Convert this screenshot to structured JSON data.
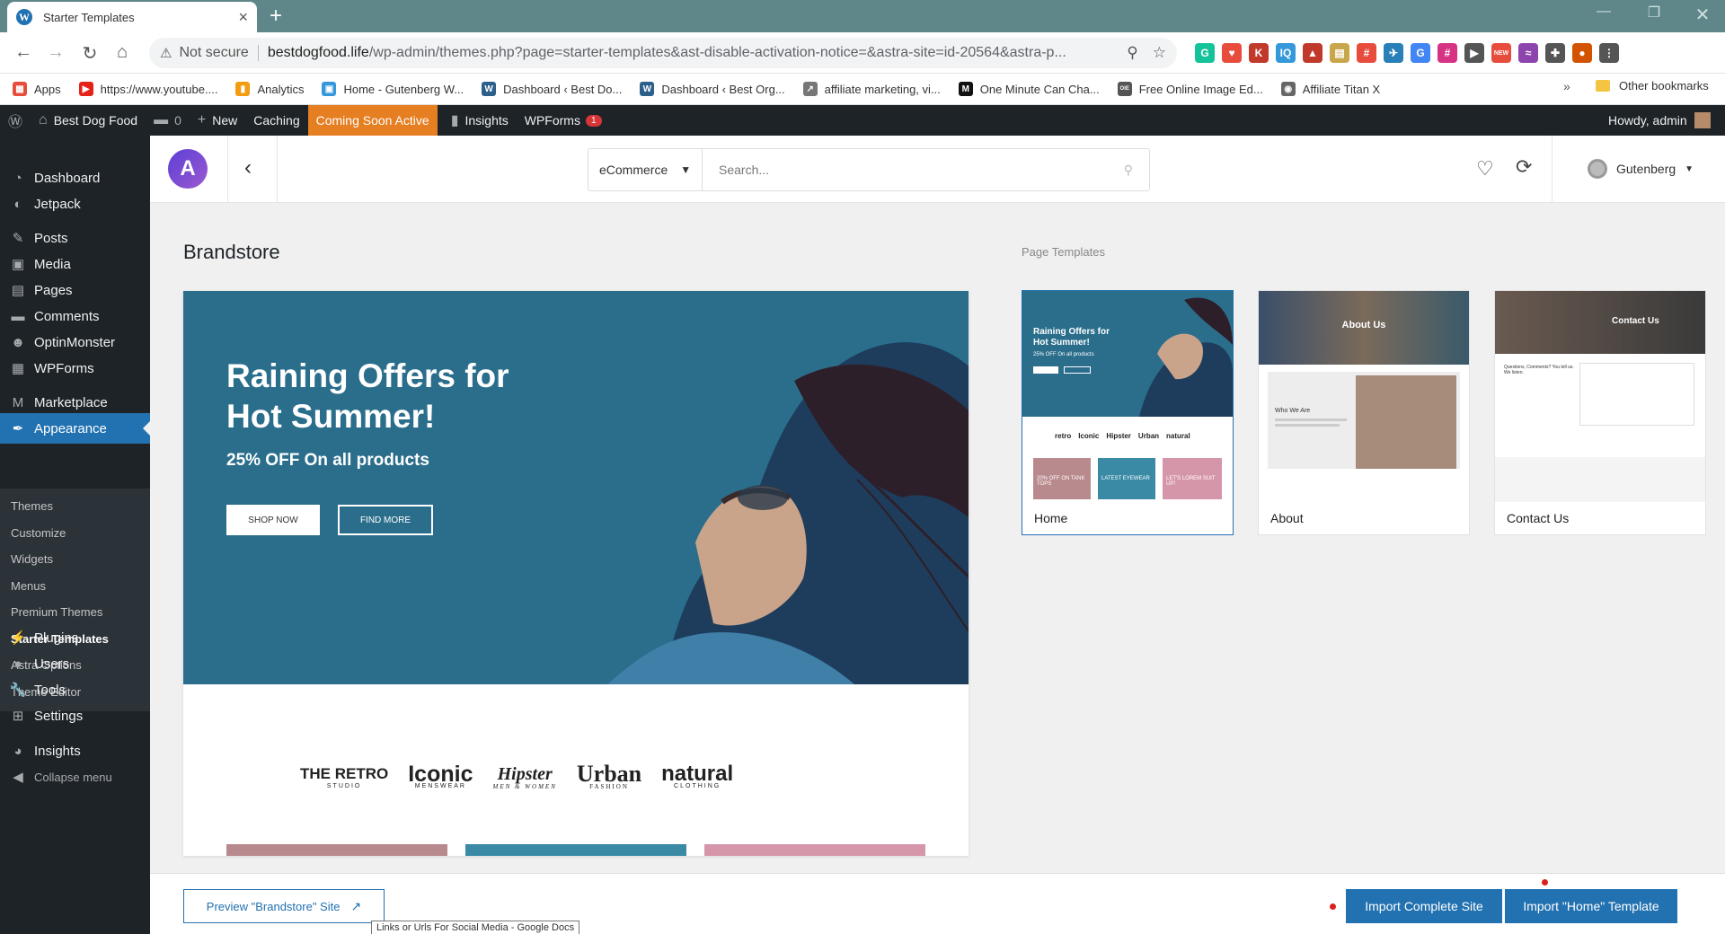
{
  "browser": {
    "tab_title": "Starter Templates",
    "new_tab": "+",
    "url_warning": "Not secure",
    "url_domain": "bestdogfood.life",
    "url_path": "/wp-admin/themes.php?page=starter-templates&ast-disable-activation-notice=&astra-site=id-20564&astra-p...",
    "extensions": [
      {
        "name": "grammarly-icon",
        "color": "#15c39a",
        "glyph": "G"
      },
      {
        "name": "heart-ext-icon",
        "color": "#e74c3c",
        "glyph": "♥"
      },
      {
        "name": "k-ext-icon",
        "color": "#c0392b",
        "glyph": "K"
      },
      {
        "name": "iq-ext-icon",
        "color": "#3498db",
        "glyph": "IQ"
      },
      {
        "name": "red-chart-ext-icon",
        "color": "#c0392b",
        "glyph": "▲"
      },
      {
        "name": "notes-ext-icon",
        "color": "#c8a64a",
        "glyph": "▤"
      },
      {
        "name": "hash-ext-icon",
        "color": "#e74c3c",
        "glyph": "#"
      },
      {
        "name": "wing-ext-icon",
        "color": "#2980b9",
        "glyph": "✈"
      },
      {
        "name": "translate-ext-icon",
        "color": "#4285f4",
        "glyph": "G"
      },
      {
        "name": "pink-hash-ext-icon",
        "color": "#d63384",
        "glyph": "#"
      },
      {
        "name": "play-ext-icon",
        "color": "#555",
        "glyph": "▶"
      },
      {
        "name": "new-ext-icon",
        "color": "#e74c3c",
        "glyph": "NEW"
      },
      {
        "name": "chart-ext-icon",
        "color": "#8e44ad",
        "glyph": "≈"
      },
      {
        "name": "puzzle-icon",
        "color": "#555",
        "glyph": "✚"
      },
      {
        "name": "profile-icon",
        "color": "#d35400",
        "glyph": "●"
      },
      {
        "name": "menu-icon",
        "color": "#555",
        "glyph": "⋮"
      }
    ]
  },
  "bookmarks": [
    {
      "label": "Apps",
      "color": "#e74c3c",
      "glyph": "▦"
    },
    {
      "label": "https://www.youtube....",
      "color": "#e62117",
      "glyph": "▶"
    },
    {
      "label": "Analytics",
      "color": "#f39c12",
      "glyph": "▮"
    },
    {
      "label": "Home - Gutenberg W...",
      "color": "#3498db",
      "glyph": "▣"
    },
    {
      "label": "Dashboard ‹ Best Do...",
      "color": "#2c5f8a",
      "glyph": "W"
    },
    {
      "label": "Dashboard ‹ Best Org...",
      "color": "#2c5f8a",
      "glyph": "W"
    },
    {
      "label": "affiliate marketing, vi...",
      "color": "#777",
      "glyph": "↗"
    },
    {
      "label": "One Minute Can Cha...",
      "color": "#111",
      "glyph": "M"
    },
    {
      "label": "Free Online Image Ed...",
      "color": "#555",
      "glyph": "OIE"
    },
    {
      "label": "Affiliate Titan X",
      "color": "#666",
      "glyph": "◉"
    }
  ],
  "bookmarks_more": "»",
  "bookmarks_other": "Other bookmarks",
  "adminbar": {
    "site": "Best Dog Food",
    "comments": "0",
    "new": "New",
    "caching": "Caching",
    "coming_soon": "Coming Soon Active",
    "insights": "Insights",
    "wpforms": "WPForms",
    "wpforms_badge": "1",
    "howdy": "Howdy, admin"
  },
  "sidebar": {
    "items": [
      {
        "key": "dashboard",
        "label": "Dashboard",
        "icon": "dashboard-icon",
        "glyph": "◔"
      },
      {
        "key": "jetpack",
        "label": "Jetpack",
        "icon": "jetpack-icon",
        "glyph": "◐"
      },
      {
        "key": "posts",
        "label": "Posts",
        "icon": "pin-icon",
        "glyph": "✎"
      },
      {
        "key": "media",
        "label": "Media",
        "icon": "media-icon",
        "glyph": "▣"
      },
      {
        "key": "pages",
        "label": "Pages",
        "icon": "pages-icon",
        "glyph": "▤"
      },
      {
        "key": "comments",
        "label": "Comments",
        "icon": "comment-icon",
        "glyph": "▬"
      },
      {
        "key": "optinmonster",
        "label": "OptinMonster",
        "icon": "optinmonster-icon",
        "glyph": "☻"
      },
      {
        "key": "wpforms",
        "label": "WPForms",
        "icon": "forms-icon",
        "glyph": "▦"
      },
      {
        "key": "marketplace",
        "label": "Marketplace",
        "icon": "marketplace-icon",
        "glyph": "M"
      },
      {
        "key": "appearance",
        "label": "Appearance",
        "icon": "brush-icon",
        "glyph": "✒"
      },
      {
        "key": "plugins",
        "label": "Plugins",
        "icon": "plugin-icon",
        "glyph": "⚡"
      },
      {
        "key": "users",
        "label": "Users",
        "icon": "users-icon",
        "glyph": "●"
      },
      {
        "key": "tools",
        "label": "Tools",
        "icon": "wrench-icon",
        "glyph": "🔧"
      },
      {
        "key": "settings",
        "label": "Settings",
        "icon": "settings-icon",
        "glyph": "⊞"
      },
      {
        "key": "insights",
        "label": "Insights",
        "icon": "insights-icon",
        "glyph": "◕"
      },
      {
        "key": "collapse",
        "label": "Collapse menu",
        "icon": "collapse-icon",
        "glyph": "◀"
      }
    ],
    "submenu": [
      "Themes",
      "Customize",
      "Widgets",
      "Menus",
      "Premium Themes",
      "Starter Templates",
      "Astra Options",
      "Theme Editor"
    ],
    "current_sub": "Starter Templates"
  },
  "header": {
    "logo_glyph": "A",
    "category": "eCommerce",
    "search_placeholder": "Search...",
    "builder": "Gutenberg"
  },
  "main": {
    "title": "Brandstore",
    "hero_title": "Raining Offers for Hot Summer!",
    "hero_sub": "25% OFF On all products",
    "shop_now": "SHOP NOW",
    "find_more": "FIND MORE",
    "brand_logos": [
      {
        "main": "THE RETRO",
        "sub": "STUDIO"
      },
      {
        "main": "Iconic",
        "sub": "MENSWEAR"
      },
      {
        "main": "Hipster",
        "sub": "MEN & WOMEN"
      },
      {
        "main": "Urban",
        "sub": "FASHION"
      },
      {
        "main": "natural",
        "sub": "CLOTHING"
      }
    ]
  },
  "page_templates": {
    "label": "Page Templates",
    "cards": [
      {
        "label": "Home",
        "selected": true,
        "mini_title": "Raining Offers for Hot Summer!",
        "mini_sub": "25% OFF On all products",
        "tiles": [
          "20% OFF ON TANK TOPS",
          "LATEST EYEWEAR",
          "LET'S LOREM SUIT UP!"
        ]
      },
      {
        "label": "About",
        "selected": false,
        "mini_title": "About Us",
        "mini_sub": "Who We Are"
      },
      {
        "label": "Contact Us",
        "selected": false,
        "mini_title": "Contact Us",
        "mini_sub": "Questions, Comments? You tell us. We listen."
      }
    ]
  },
  "footer": {
    "preview": "Preview \"Brandstore\" Site",
    "tooltip": "Links or Urls For Social Media - Google Docs",
    "import_site": "Import Complete Site",
    "import_home": "Import \"Home\" Template"
  },
  "colors": {
    "wp_blue": "#2271b1",
    "admin_dark": "#1d2327",
    "hero": "#2b6e8c",
    "coming_soon": "#e67e22"
  }
}
